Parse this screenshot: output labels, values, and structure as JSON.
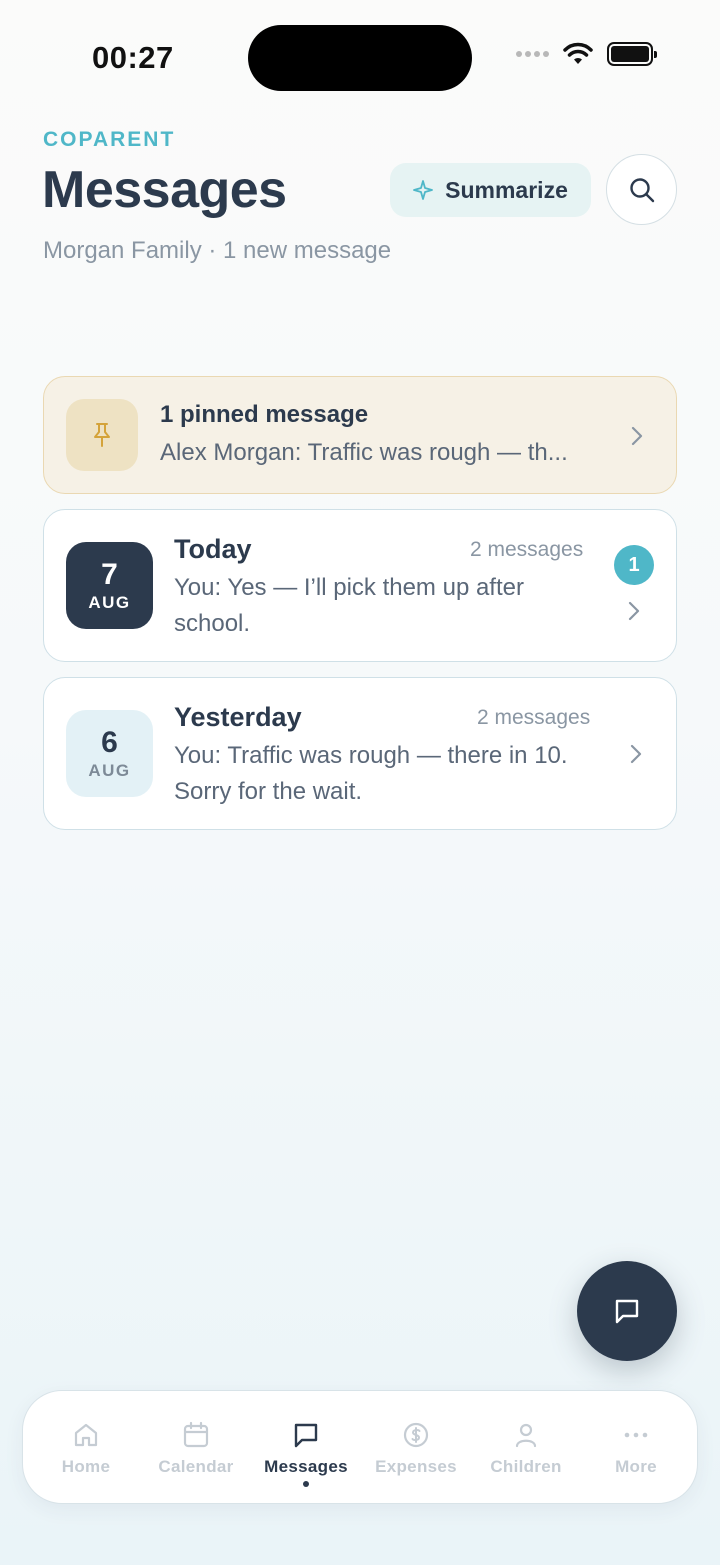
{
  "status_bar": {
    "time": "00:27"
  },
  "header": {
    "eyebrow": "COPARENT",
    "title": "Messages",
    "subtitle": "Morgan Family · 1 new message",
    "summarize_label": "Summarize"
  },
  "pinned": {
    "title": "1 pinned message",
    "preview": "Alex Morgan: Traffic was rough — th..."
  },
  "days": [
    {
      "day": "7",
      "month": "AUG",
      "label": "Today",
      "count": "2 messages",
      "preview": "You: Yes — I’ll pick them up after school.",
      "unread": "1"
    },
    {
      "day": "6",
      "month": "AUG",
      "label": "Yesterday",
      "count": "2 messages",
      "preview": "You: Traffic was rough — there in 10. Sorry for the wait."
    }
  ],
  "tabs": [
    {
      "label": "Home",
      "icon": "home-icon"
    },
    {
      "label": "Calendar",
      "icon": "calendar-icon"
    },
    {
      "label": "Messages",
      "icon": "message-icon",
      "active": true
    },
    {
      "label": "Expenses",
      "icon": "dollar-icon"
    },
    {
      "label": "Children",
      "icon": "person-icon"
    },
    {
      "label": "More",
      "icon": "more-icon"
    }
  ],
  "colors": {
    "accent": "#4fb7c8",
    "ink": "#2c3a4d",
    "pinned_bg": "#f6f1e6"
  }
}
